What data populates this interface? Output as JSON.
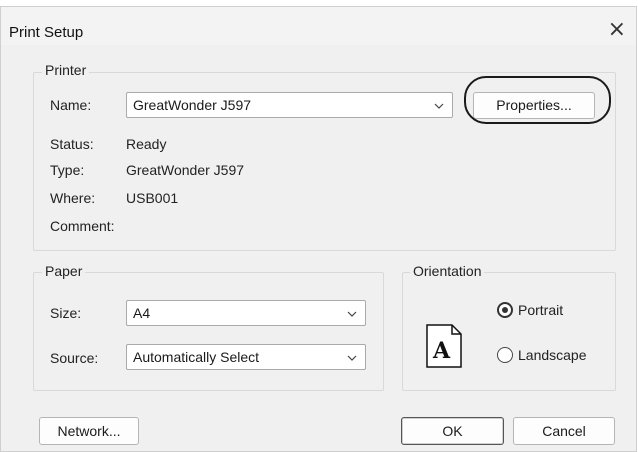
{
  "dialog": {
    "title": "Print Setup",
    "close_glyph": "×"
  },
  "printer": {
    "legend": "Printer",
    "name_label": "Name:",
    "name_value": "GreatWonder J597",
    "properties_button": "Properties...",
    "status_label": "Status:",
    "status_value": "Ready",
    "type_label": "Type:",
    "type_value": "GreatWonder J597",
    "where_label": "Where:",
    "where_value": "USB001",
    "comment_label": "Comment:",
    "comment_value": ""
  },
  "paper": {
    "legend": "Paper",
    "size_label": "Size:",
    "size_value": "A4",
    "source_label": "Source:",
    "source_value": "Automatically Select"
  },
  "orientation": {
    "legend": "Orientation",
    "portrait_label": "Portrait",
    "landscape_label": "Landscape",
    "selected": "Portrait",
    "page_icon_letter": "A",
    "page_icon_name": "portrait-page-icon"
  },
  "buttons": {
    "network": "Network...",
    "ok": "OK",
    "cancel": "Cancel"
  },
  "icons": {
    "close": "close-icon",
    "dropdown": "chevron-down-icon"
  }
}
